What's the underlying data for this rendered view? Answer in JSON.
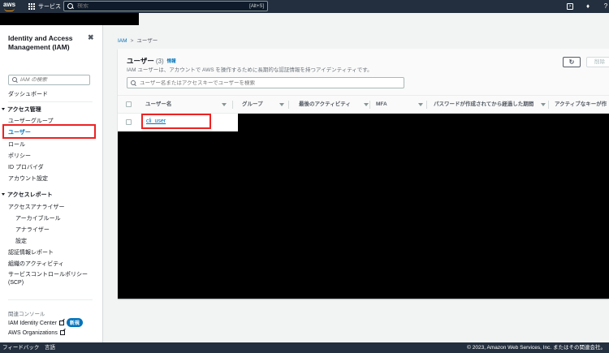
{
  "topbar": {
    "logo": "aws",
    "services_label": "サービス",
    "search_placeholder": "検索",
    "search_shortcut": "[Alt+S]"
  },
  "sidebar": {
    "title": "Identity and Access Management (IAM)",
    "close": "✖",
    "search_placeholder": "IAM の検索",
    "dashboard": "ダッシュボード",
    "access_mgmt": {
      "label": "アクセス管理",
      "items": [
        "ユーザーグループ",
        "ユーザー",
        "ロール",
        "ポリシー",
        "ID プロバイダ",
        "アカウント設定"
      ]
    },
    "access_reports": {
      "label": "アクセスレポート",
      "analyzer": "アクセスアナライザー",
      "analyzer_sub": [
        "アーカイブルール",
        "アナライザー",
        "設定"
      ],
      "items": [
        "認証情報レポート",
        "組織のアクティビティ",
        "サービスコントロールポリシー (SCP)"
      ]
    },
    "related_label": "関連コンソール",
    "related": [
      {
        "label": "IAM Identity Center",
        "badge": "新規"
      },
      {
        "label": "AWS Organizations"
      }
    ]
  },
  "breadcrumb": {
    "root": "IAM",
    "current": "ユーザー"
  },
  "users_panel": {
    "title": "ユーザー",
    "count": "(3)",
    "info": "情報",
    "description": "IAM ユーザーは、アカウントで AWS を操作するために長期的な認証情報を持つアイデンティティです。",
    "refresh_icon": "refresh-icon",
    "delete_label": "削除",
    "search_placeholder": "ユーザー名またはアクセスキーでユーザーを検索",
    "columns": [
      "ユーザー名",
      "グループ",
      "最後のアクティビティ",
      "MFA",
      "パスワードが作成されてから経過した期間",
      "アクティブなキーが作"
    ],
    "rows": [
      {
        "username": "cli_user"
      }
    ]
  },
  "footer": {
    "feedback": "フィードバック",
    "language": "言語",
    "copyright": "© 2023, Amazon Web Services, Inc. またはその関連会社。"
  },
  "colors": {
    "accent": "#0073bb",
    "nav_bg": "#232f3e",
    "highlight": "#e22222"
  }
}
